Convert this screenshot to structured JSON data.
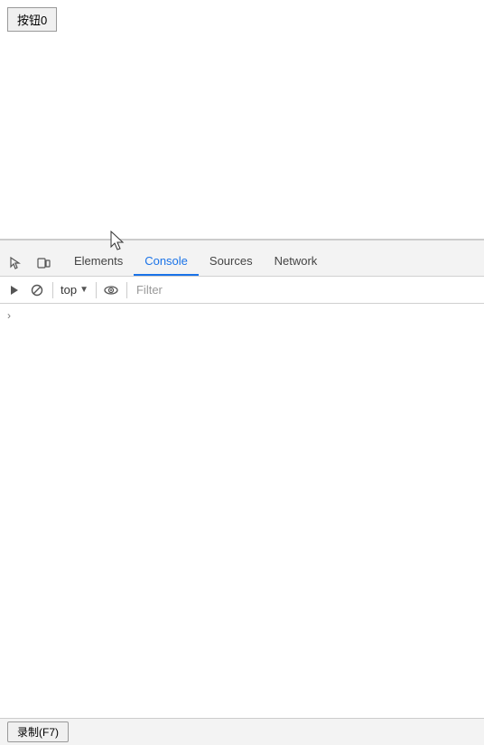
{
  "page": {
    "button_label": "按钮0"
  },
  "devtools": {
    "tabs": [
      {
        "id": "elements",
        "label": "Elements",
        "active": false
      },
      {
        "id": "console",
        "label": "Console",
        "active": true
      },
      {
        "id": "sources",
        "label": "Sources",
        "active": false
      },
      {
        "id": "network",
        "label": "Network",
        "active": false
      }
    ],
    "toolbar": {
      "top_label": "top",
      "filter_placeholder": "Filter"
    }
  },
  "bottom_bar": {
    "record_label": "录制(F7)"
  }
}
